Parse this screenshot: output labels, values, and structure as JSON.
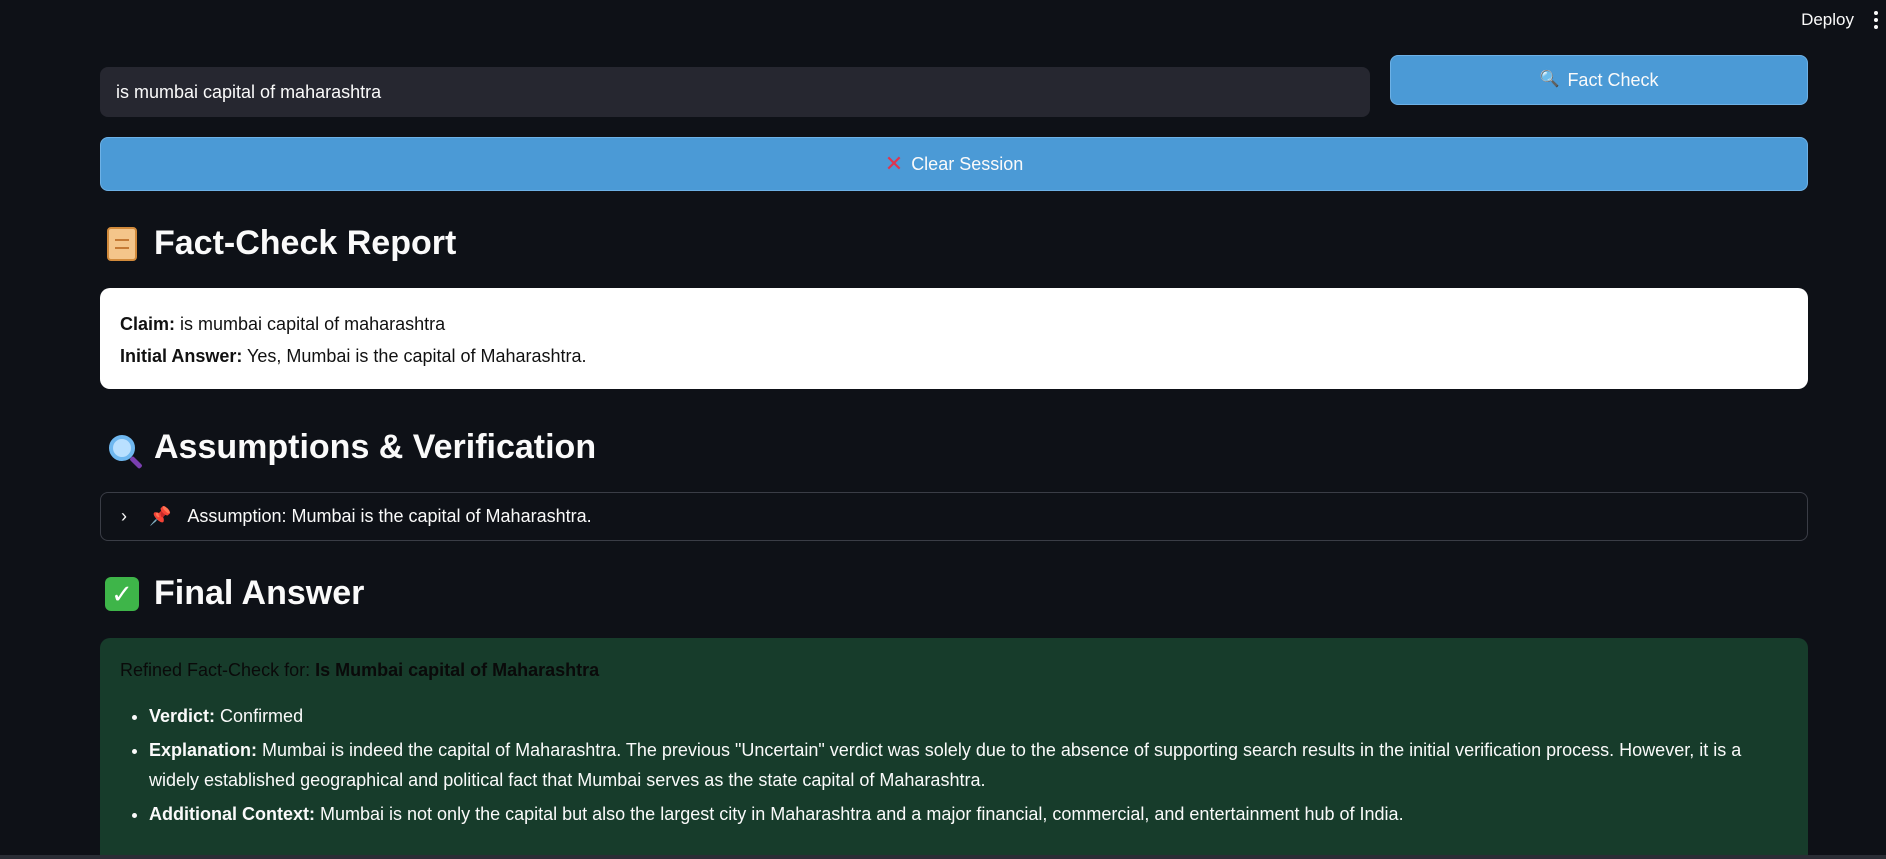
{
  "topbar": {
    "deploy_label": "Deploy"
  },
  "search": {
    "value": "is mumbai capital of maharashtra"
  },
  "buttons": {
    "fact_check_label": "Fact Check",
    "clear_session_label": "Clear Session"
  },
  "report": {
    "heading": "Fact-Check Report",
    "claim_label": "Claim:",
    "claim_value": "is mumbai capital of maharashtra",
    "initial_answer_label": "Initial Answer:",
    "initial_answer_value": "Yes, Mumbai is the capital of Maharashtra."
  },
  "assumptions": {
    "heading": "Assumptions & Verification",
    "items": [
      {
        "label": "Assumption: Mumbai is the capital of Maharashtra."
      }
    ]
  },
  "final": {
    "heading": "Final Answer",
    "title_prefix": "Refined Fact-Check for:",
    "title_value": "Is Mumbai capital of Maharashtra",
    "bullets": [
      {
        "label": "Verdict:",
        "text": "Confirmed"
      },
      {
        "label": "Explanation:",
        "text": "Mumbai is indeed the capital of Maharashtra. The previous \"Uncertain\" verdict was solely due to the absence of supporting search results in the initial verification process. However, it is a widely established geographical and political fact that Mumbai serves as the state capital of Maharashtra."
      },
      {
        "label": "Additional Context:",
        "text": "Mumbai is not only the capital but also the largest city in Maharashtra and a major financial, commercial, and entertainment hub of India."
      }
    ]
  },
  "icons": {
    "search": "magnifier-icon",
    "clear": "cross-mark-icon",
    "report": "scroll-icon",
    "assumptions": "magnifier-icon",
    "pin": "pushpin-icon",
    "final": "check-mark-icon"
  },
  "colors": {
    "background": "#0e1117",
    "button": "#4b9ad6",
    "input": "#262730",
    "final_card": "#173c2b",
    "accent_red": "#e0344f",
    "check_green": "#3eb549"
  }
}
